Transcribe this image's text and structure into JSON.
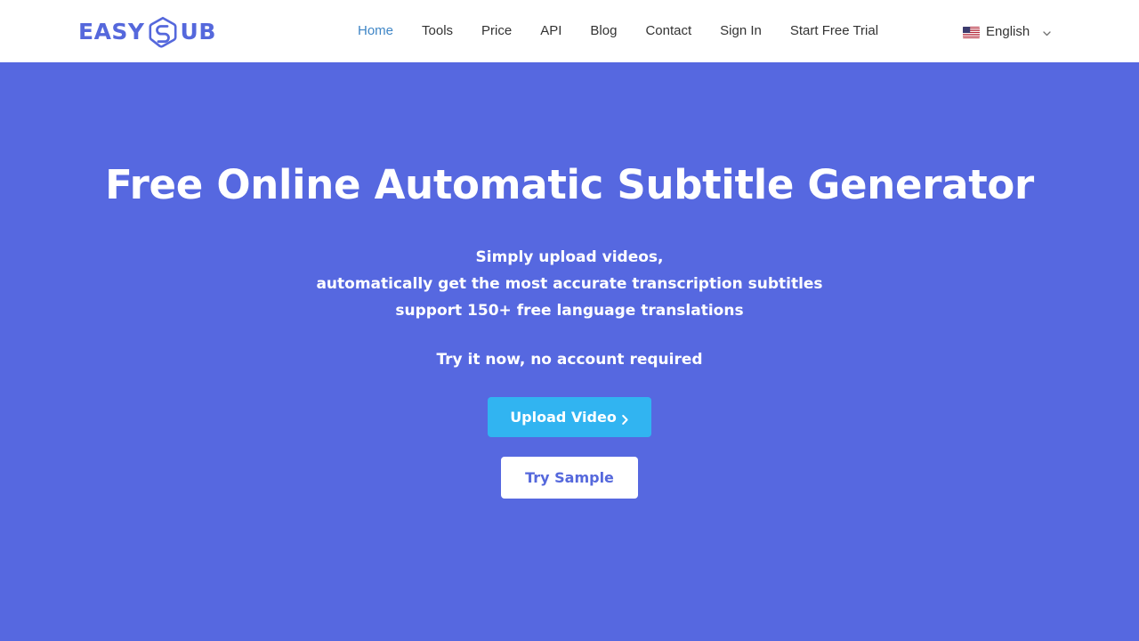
{
  "brand": {
    "name_part1": "EASY",
    "name_part2": "UB",
    "logo_icon": "s-hexagon-logo-icon",
    "color": "#5568dc"
  },
  "nav": {
    "items": [
      {
        "label": "Home",
        "active": true
      },
      {
        "label": "Tools",
        "active": false
      },
      {
        "label": "Price",
        "active": false
      },
      {
        "label": "API",
        "active": false
      },
      {
        "label": "Blog",
        "active": false
      },
      {
        "label": "Contact",
        "active": false
      },
      {
        "label": "Sign In",
        "active": false
      },
      {
        "label": "Start Free Trial",
        "active": false
      }
    ],
    "active_color": "#3f86c6",
    "link_color": "#333333",
    "language": {
      "label": "English",
      "flag_icon": "us-flag-icon",
      "chevron_icon": "chevron-down-icon"
    }
  },
  "hero": {
    "background_color": "#5668e0",
    "title": "Free Online Automatic Subtitle Generator",
    "subtitle_lines": [
      "Simply upload videos,",
      "automatically get the most accurate transcription subtitles",
      "support 150+ free language translations"
    ],
    "note": "Try it now, no account required",
    "primary_button": {
      "label": "Upload Video",
      "icon": "chevron-right-icon",
      "color": "#31b4f1",
      "text_color": "#ffffff"
    },
    "secondary_button": {
      "label": "Try Sample",
      "color": "#ffffff",
      "text_color": "#5568dc"
    }
  }
}
